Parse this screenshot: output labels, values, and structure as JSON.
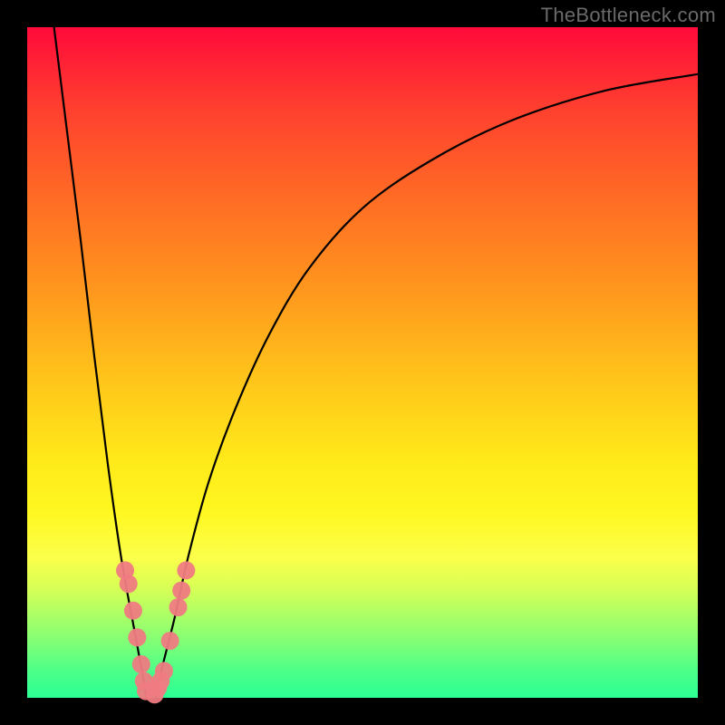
{
  "watermark": "TheBottleneck.com",
  "chart_data": {
    "type": "line",
    "title": "",
    "xlabel": "",
    "ylabel": "",
    "xlim": [
      0,
      100
    ],
    "ylim": [
      0,
      100
    ],
    "grid": false,
    "series": [
      {
        "name": "left-branch",
        "x": [
          4,
          6,
          8,
          10,
          12,
          14,
          16,
          17.3,
          17.8
        ],
        "y": [
          100,
          84,
          68,
          51,
          35,
          21,
          10,
          3,
          0
        ]
      },
      {
        "name": "right-branch",
        "x": [
          19.2,
          20,
          22,
          24,
          27,
          31,
          36,
          42,
          50,
          60,
          72,
          86,
          100
        ],
        "y": [
          0,
          4,
          12,
          21,
          32,
          43,
          54,
          64,
          73,
          80,
          86,
          90.5,
          93
        ]
      }
    ],
    "markers": [
      {
        "series": "left-branch",
        "x": 14.6,
        "y": 19.0
      },
      {
        "series": "left-branch",
        "x": 15.1,
        "y": 17.0
      },
      {
        "series": "left-branch",
        "x": 15.8,
        "y": 13.0
      },
      {
        "series": "left-branch",
        "x": 16.4,
        "y": 9.0
      },
      {
        "series": "left-branch",
        "x": 17.0,
        "y": 5.0
      },
      {
        "series": "left-branch",
        "x": 17.4,
        "y": 2.5
      },
      {
        "series": "left-branch",
        "x": 17.7,
        "y": 1.0
      },
      {
        "series": "right-branch",
        "x": 19.0,
        "y": 0.5
      },
      {
        "series": "right-branch",
        "x": 19.5,
        "y": 1.5
      },
      {
        "series": "right-branch",
        "x": 19.9,
        "y": 2.5
      },
      {
        "series": "right-branch",
        "x": 20.4,
        "y": 4.0
      },
      {
        "series": "right-branch",
        "x": 21.3,
        "y": 8.5
      },
      {
        "series": "right-branch",
        "x": 22.5,
        "y": 13.5
      },
      {
        "series": "right-branch",
        "x": 23.0,
        "y": 16.0
      },
      {
        "series": "right-branch",
        "x": 23.7,
        "y": 19.0
      }
    ],
    "background_gradient": {
      "orientation": "vertical",
      "stops": [
        {
          "pos": 0.0,
          "color": "#ff0a3a"
        },
        {
          "pos": 0.5,
          "color": "#ffc31a"
        },
        {
          "pos": 0.8,
          "color": "#fcff4a"
        },
        {
          "pos": 1.0,
          "color": "#2bff93"
        }
      ]
    }
  }
}
